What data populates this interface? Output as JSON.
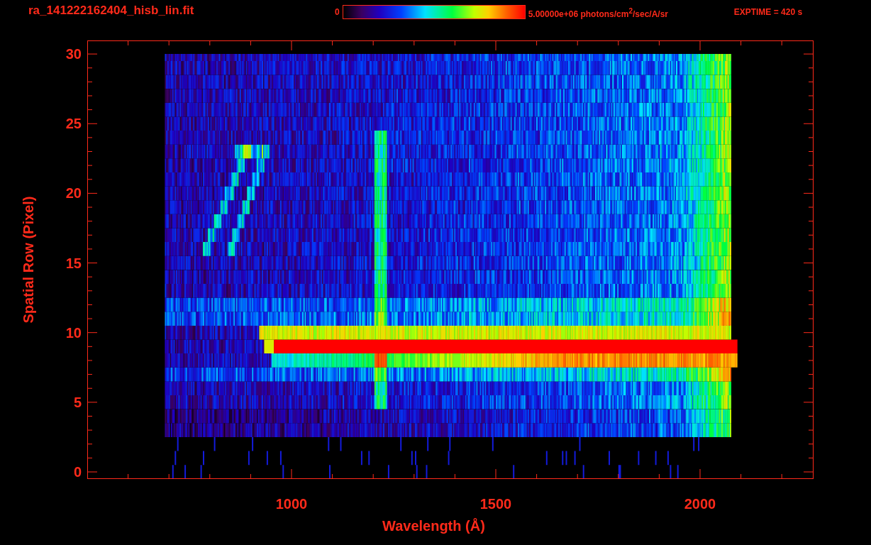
{
  "header": {
    "title": "ra_141222162404_hisb_lin.fit",
    "colorbar": {
      "min_label": "0",
      "max_label": "5.00000e+06 photons/cm$^{2}$/sec/A/sr"
    },
    "exposure": "EXPTIME = 420 s"
  },
  "plot": {
    "ylabel": "Spatial Row (Pixel)",
    "xlabel": "Wavelength (Å)",
    "xticks": [
      "1000",
      "1500",
      "2000"
    ],
    "yticks": [
      "30",
      "25",
      "20",
      "15",
      "10",
      "5",
      "0"
    ]
  }
}
